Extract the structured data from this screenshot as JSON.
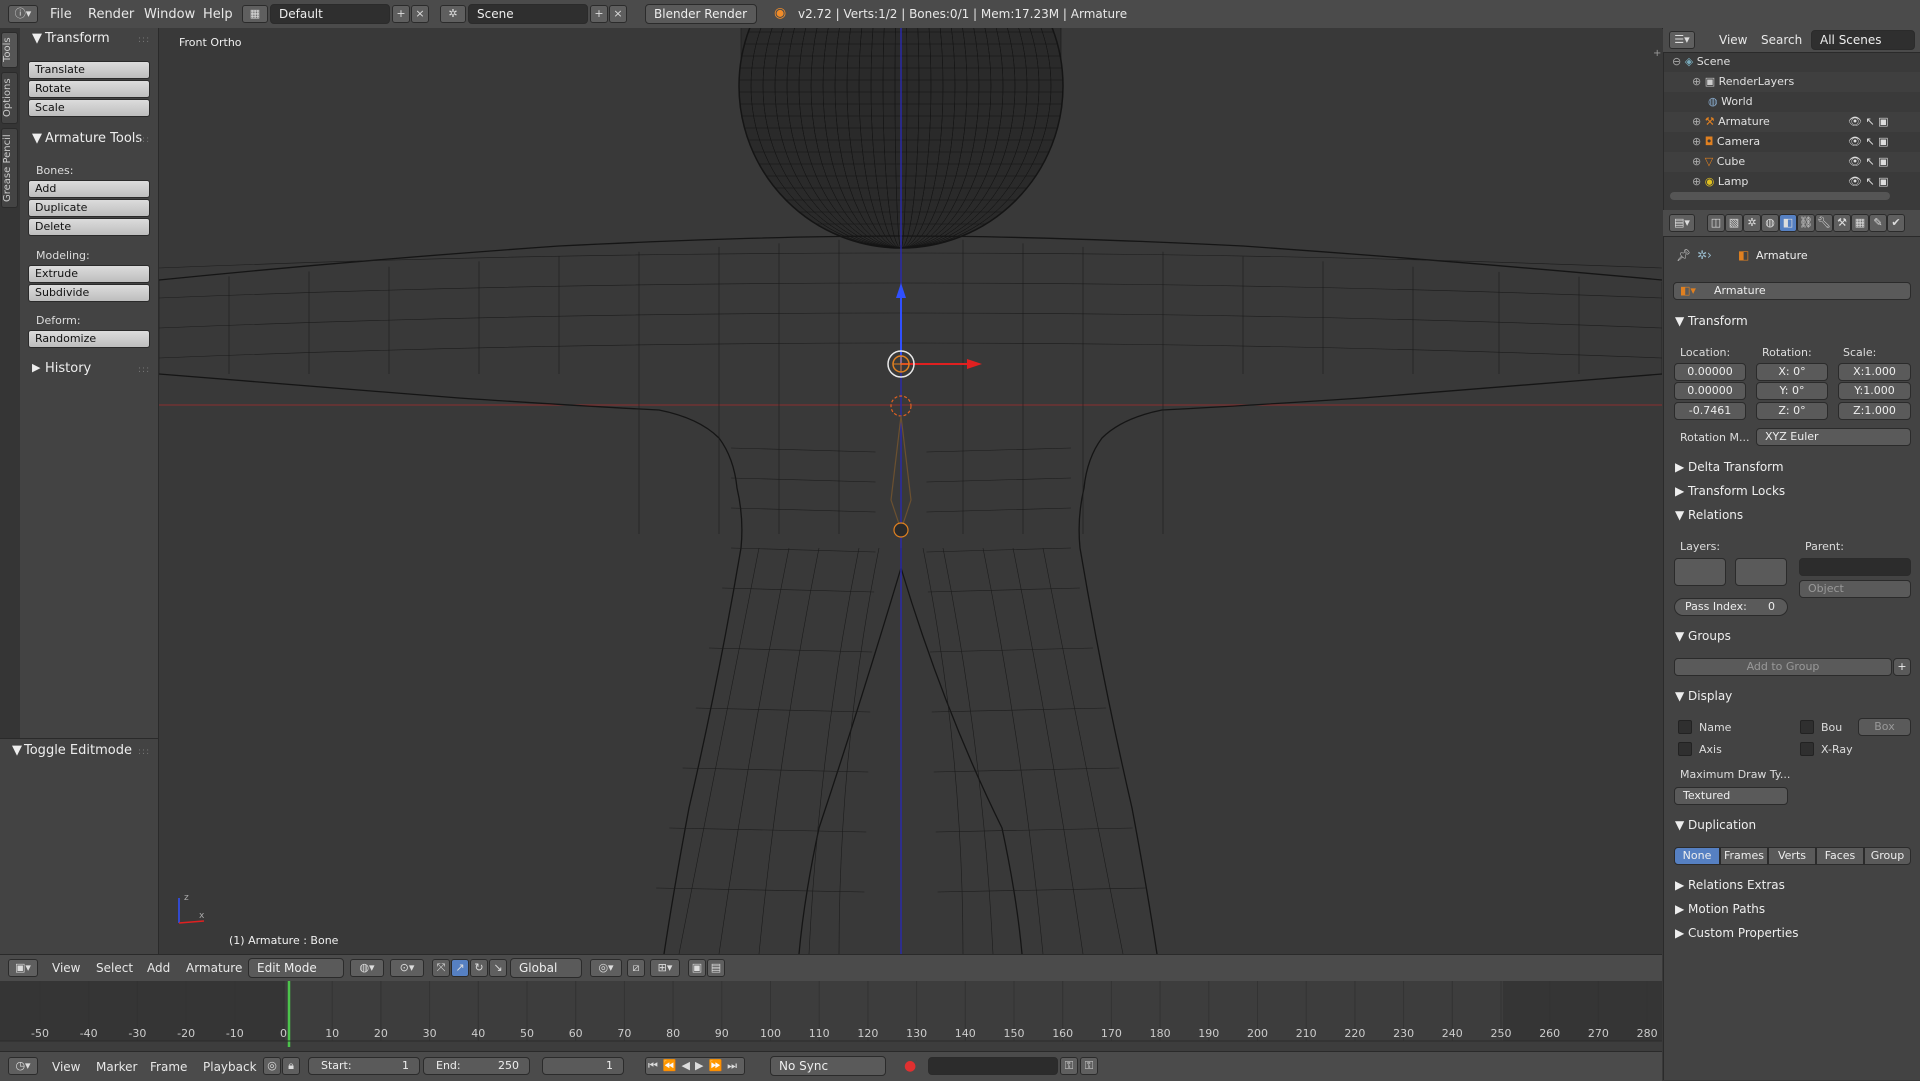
{
  "topbar": {
    "menus": [
      "File",
      "Render",
      "Window",
      "Help"
    ],
    "layout": "Default",
    "scene": "Scene",
    "engine": "Blender Render",
    "stats": "v2.72 | Verts:1/2 | Bones:0/1 | Mem:17.23M | Armature"
  },
  "left_tabs": [
    "Tools",
    "Options",
    "Grease Pencil"
  ],
  "toolshelf": {
    "transform_header": "Transform",
    "transform_buttons": [
      "Translate",
      "Rotate",
      "Scale"
    ],
    "armature_header": "Armature Tools",
    "bones_label": "Bones:",
    "bones_buttons": [
      "Add",
      "Duplicate",
      "Delete"
    ],
    "modeling_label": "Modeling:",
    "modeling_buttons": [
      "Extrude",
      "Subdivide"
    ],
    "deform_label": "Deform:",
    "deform_buttons": [
      "Randomize"
    ],
    "history_header": "History"
  },
  "operator_panel": {
    "header": "Toggle Editmode"
  },
  "viewport": {
    "view_label": "Front Ortho",
    "object_label": "(1) Armature : Bone"
  },
  "view3d_header": {
    "menus": [
      "View",
      "Select",
      "Add",
      "Armature"
    ],
    "mode": "Edit Mode",
    "orientation": "Global"
  },
  "timeline": {
    "ticks": [
      "-50",
      "-40",
      "-30",
      "-20",
      "-10",
      "0",
      "10",
      "20",
      "30",
      "40",
      "50",
      "60",
      "70",
      "80",
      "90",
      "100",
      "110",
      "120",
      "130",
      "140",
      "150",
      "160",
      "170",
      "180",
      "190",
      "200",
      "210",
      "220",
      "230",
      "240",
      "250",
      "260",
      "270",
      "280"
    ],
    "current_frame": 1,
    "menus": [
      "View",
      "Marker",
      "Frame",
      "Playback"
    ],
    "start_label": "Start:",
    "start": "1",
    "end_label": "End:",
    "end": "250",
    "frame": "1",
    "sync": "No Sync"
  },
  "outliner": {
    "menus": [
      "View",
      "Search"
    ],
    "filter": "All Scenes",
    "items": [
      "Scene",
      "RenderLayers",
      "World",
      "Armature",
      "Camera",
      "Cube",
      "Lamp"
    ]
  },
  "properties": {
    "breadcrumb": "Armature",
    "object_name": "Armature",
    "transform_header": "Transform",
    "location_label": "Location:",
    "rotation_label": "Rotation:",
    "scale_label": "Scale:",
    "location": [
      "0.00000",
      "0.00000",
      "-0.7461"
    ],
    "rotation": [
      "X:",
      "Y:",
      "Z:"
    ],
    "rotation_values": [
      "0°",
      "0°",
      "0°"
    ],
    "scale": [
      "X:1.000",
      "Y:1.000",
      "Z:1.000"
    ],
    "rotation_mode_label": "Rotation M...",
    "rotation_mode": "XYZ Euler",
    "delta_transform": "Delta Transform",
    "transform_locks": "Transform Locks",
    "relations": "Relations",
    "layers_label": "Layers:",
    "parent_label": "Parent:",
    "parent_type": "Object",
    "pass_index_label": "Pass Index:",
    "pass_index": "0",
    "groups": "Groups",
    "add_to_group": "Add to Group",
    "display": "Display",
    "name_label": "Name",
    "bou_label": "Bou",
    "bou_value": "Box",
    "axis_label": "Axis",
    "xray_label": "X-Ray",
    "max_draw_label": "Maximum Draw Ty...",
    "max_draw": "Textured",
    "duplication": "Duplication",
    "dup_options": [
      "None",
      "Frames",
      "Verts",
      "Faces",
      "Group"
    ],
    "relations_extras": "Relations Extras",
    "motion_paths": "Motion Paths",
    "custom_properties": "Custom Properties"
  },
  "colors": {
    "accent": "#5680c2",
    "panel": "#434343",
    "viewport": "#393939"
  }
}
